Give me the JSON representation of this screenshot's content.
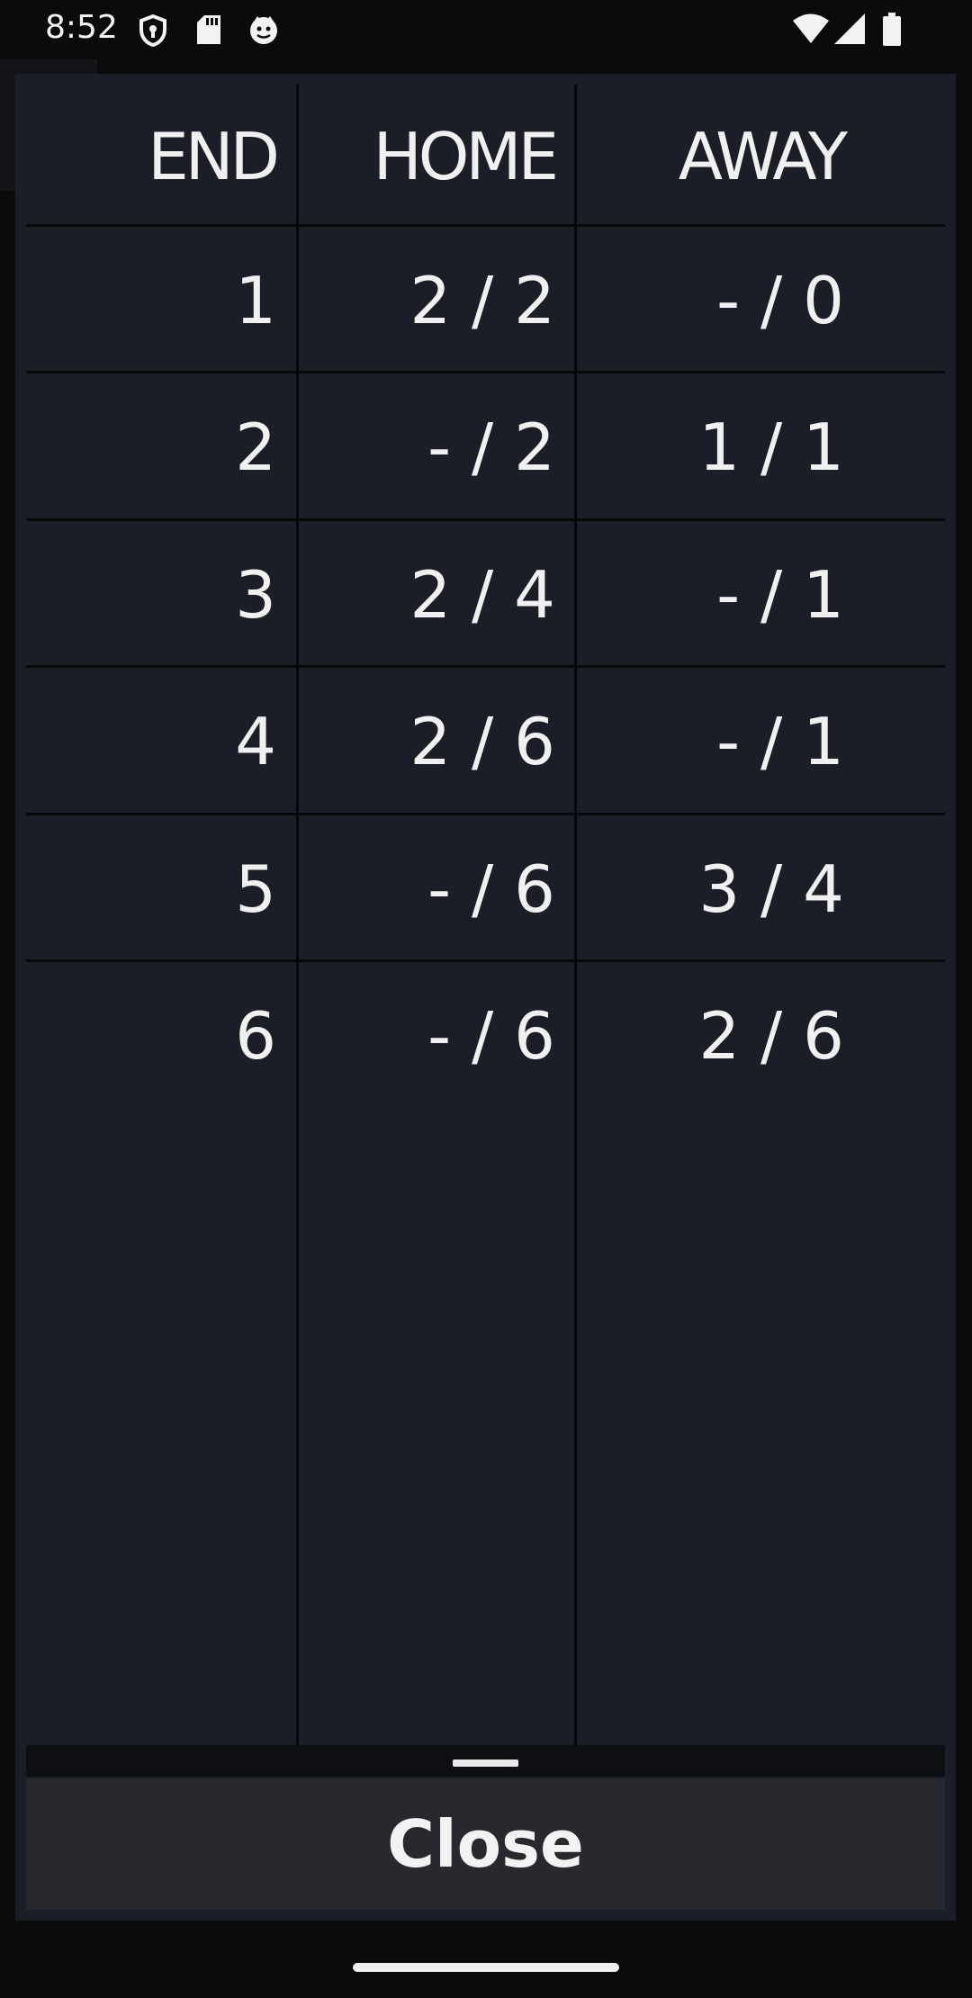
{
  "status_bar": {
    "time": "8:52",
    "icons_left": [
      "shield-icon",
      "sd-card-icon",
      "cat-face-icon"
    ],
    "icons_right": [
      "wifi-icon",
      "cellular-signal-icon",
      "battery-icon"
    ]
  },
  "scoreboard": {
    "headers": {
      "end": "END",
      "home": "HOME",
      "away": "AWAY"
    },
    "rows": [
      {
        "end": "1",
        "home": "2 / 2",
        "away": "- / 0"
      },
      {
        "end": "2",
        "home": "- / 2",
        "away": "1 / 1"
      },
      {
        "end": "3",
        "home": "2 / 4",
        "away": "- / 1"
      },
      {
        "end": "4",
        "home": "2 / 6",
        "away": "- / 1"
      },
      {
        "end": "5",
        "home": "- / 6",
        "away": "3 / 4"
      },
      {
        "end": "6",
        "home": "- / 6",
        "away": "2 / 6"
      }
    ]
  },
  "dialog": {
    "close_label": "Close"
  },
  "colors": {
    "dialog_bg": "#1b1e26",
    "grid_line": "#07080a",
    "button_bg": "#28292e",
    "text": "#f0f0f0"
  }
}
